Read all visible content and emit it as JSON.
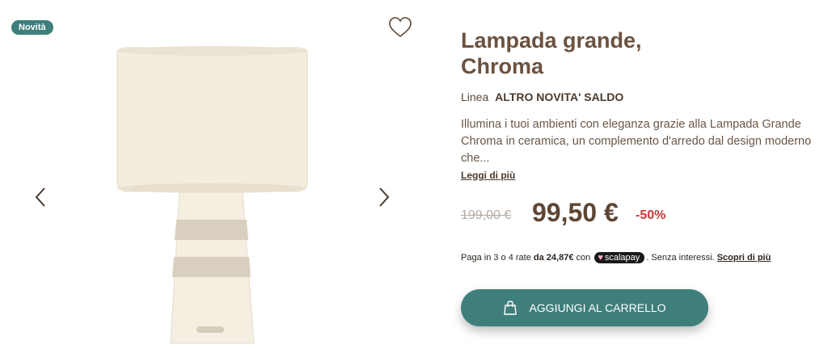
{
  "gallery": {
    "badge": "Novità",
    "icons": {
      "favorite": "heart-icon",
      "prev": "chevron-left-icon",
      "next": "chevron-right-icon"
    },
    "image_alt": "lamp"
  },
  "product": {
    "title": "Lampada grande, Chroma",
    "line_label": "Linea",
    "line_value": "ALTRO NOVITA' SALDO",
    "description": "Illumina i tuoi ambienti con eleganza grazie alla Lampada Grande Chroma in ceramica, un complemento d'arredo dal design moderno che...",
    "read_more": "Leggi di più"
  },
  "pricing": {
    "old_price": "199,00 €",
    "price": "99,50 €",
    "discount": "-50%"
  },
  "installments": {
    "prefix": "Paga in 3 o 4 rate",
    "amount": "da 24,87€",
    "with": "con",
    "provider": "scalapay",
    "suffix": ". Senza interessi.",
    "link": "Scopri di più"
  },
  "cart": {
    "label": "AGGIUNGI AL CARRELLO",
    "icon": "shopping-bag-icon"
  },
  "colors": {
    "accent": "#3f7f7b",
    "brown": "#6b5240",
    "discount": "#c9393a"
  }
}
